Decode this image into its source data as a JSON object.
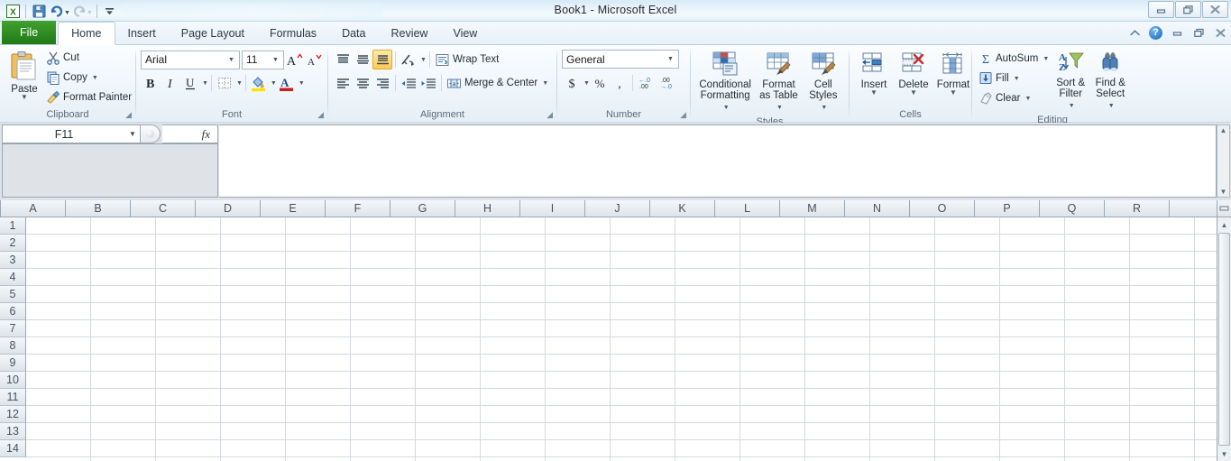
{
  "window": {
    "title": "Book1  -  Microsoft Excel",
    "controls": [
      {
        "name": "minimize-button",
        "glyph": "—"
      },
      {
        "name": "restore-button",
        "glyph": "❐"
      },
      {
        "name": "close-button",
        "glyph": "✕"
      }
    ]
  },
  "quick_access": {
    "app_icon": "excel-icon",
    "items": [
      {
        "name": "save-button",
        "icon": "save-icon"
      },
      {
        "name": "undo-button",
        "icon": "undo-icon",
        "has_dropdown": true
      },
      {
        "name": "redo-button",
        "icon": "redo-icon",
        "has_dropdown": true
      },
      {
        "name": "customize-quick-access-toolbar-button",
        "icon": "chevron-down-icon"
      }
    ]
  },
  "tabs": [
    {
      "label": "File",
      "active": false,
      "file": true
    },
    {
      "label": "Home",
      "active": true
    },
    {
      "label": "Insert",
      "active": false
    },
    {
      "label": "Page Layout",
      "active": false
    },
    {
      "label": "Formulas",
      "active": false
    },
    {
      "label": "Data",
      "active": false
    },
    {
      "label": "Review",
      "active": false
    },
    {
      "label": "View",
      "active": false
    }
  ],
  "tab_right_buttons": [
    {
      "name": "minimize-ribbon-button",
      "glyph": "▲"
    },
    {
      "name": "help-button",
      "glyph": "?"
    },
    {
      "name": "window-minimize-button",
      "glyph": "—"
    },
    {
      "name": "window-restore-button",
      "glyph": "❐"
    },
    {
      "name": "window-close-button",
      "glyph": "✕"
    }
  ],
  "ribbon": {
    "clipboard": {
      "label": "Clipboard",
      "paste": "Paste",
      "cut": "Cut",
      "copy": "Copy",
      "format_painter": "Format Painter"
    },
    "font": {
      "label": "Font",
      "font_name": "Arial",
      "font_size": "11",
      "buttons": {
        "grow": "A",
        "shrink": "A",
        "bold": "B",
        "italic": "I",
        "underline": "U"
      }
    },
    "alignment": {
      "label": "Alignment",
      "wrap_text": "Wrap Text",
      "merge_center": "Merge & Center"
    },
    "number": {
      "label": "Number",
      "format": "General",
      "currency": "$",
      "percent": "%",
      "comma": ","
    },
    "styles": {
      "label": "Styles",
      "conditional_formatting": "Conditional\nFormatting",
      "conditional_formatting_line1": "Conditional",
      "conditional_formatting_line2": "Formatting",
      "format_as_table_line1": "Format",
      "format_as_table_line2": "as Table",
      "cell_styles_line1": "Cell",
      "cell_styles_line2": "Styles"
    },
    "cells": {
      "label": "Cells",
      "insert": "Insert",
      "delete": "Delete",
      "format": "Format"
    },
    "editing": {
      "label": "Editing",
      "autosum": "AutoSum",
      "fill": "Fill",
      "clear": "Clear",
      "sort_filter_line1": "Sort &",
      "sort_filter_line2": "Filter",
      "find_select_line1": "Find &",
      "find_select_line2": "Select"
    }
  },
  "formula_bar": {
    "name_box_value": "F11",
    "formula_value": "",
    "fx_label": "fx",
    "expanded": true
  },
  "grid": {
    "columns": [
      "A",
      "B",
      "C",
      "D",
      "E",
      "F",
      "G",
      "H",
      "I",
      "J",
      "K",
      "L",
      "M",
      "N",
      "O",
      "P",
      "Q",
      "R"
    ],
    "rows": [
      "1",
      "2",
      "3",
      "4",
      "5",
      "6",
      "7",
      "8",
      "9",
      "10",
      "11",
      "12",
      "13",
      "14"
    ],
    "active_cell": "F11"
  },
  "colors": {
    "file_tab_green": "#1e7a17",
    "title_bar": "#e9f4fb",
    "ribbon_bg": "#eff6fb",
    "grid_line": "#d4d9de",
    "header_text": "#46525d",
    "accent_orange": "#ffcb55"
  }
}
